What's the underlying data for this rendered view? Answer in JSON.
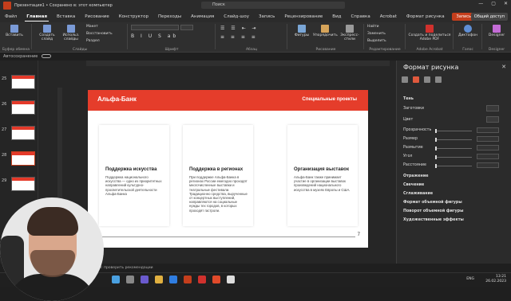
{
  "titlebar": {
    "title": "Презентация1 • Сохранено в: этот компьютер",
    "search_placeholder": "Поиск",
    "controls": [
      "—",
      "▢",
      "✕"
    ]
  },
  "ribbon_tabs": [
    "Файл",
    "Главная",
    "Вставка",
    "Рисование",
    "Конструктор",
    "Переходы",
    "Анимация",
    "Слайд-шоу",
    "Запись",
    "Рецензирование",
    "Вид",
    "Справка",
    "Acrobat",
    "Формат рисунка"
  ],
  "active_tab": "Главная",
  "share_label": "Запись",
  "share_button": "Общий доступ",
  "ribbon_groups": [
    {
      "label": "Буфер обмена",
      "buttons": [
        "Вставить"
      ]
    },
    {
      "label": "Слайды",
      "buttons": [
        "Создать слайд",
        "Использ. слайды",
        "Макет",
        "Восстановить",
        "Раздел"
      ]
    },
    {
      "label": "Шрифт",
      "buttons": []
    },
    {
      "label": "Абзац",
      "buttons": []
    },
    {
      "label": "Рисование",
      "buttons": [
        "Фигуры",
        "Упорядочить",
        "Экспресс-стили"
      ]
    },
    {
      "label": "Редактирование",
      "buttons": [
        "Найти",
        "Заменить",
        "Выделить"
      ]
    },
    {
      "label": "Adobe Acrobat",
      "buttons": [
        "Создать и поделиться Adobe PDF"
      ]
    },
    {
      "label": "Голос",
      "buttons": [
        "Диктофон"
      ]
    },
    {
      "label": "Designer",
      "buttons": [
        "Designer"
      ]
    }
  ],
  "autosave_label": "Автосохранение",
  "thumbnails": [
    {
      "num": "25"
    },
    {
      "num": "26"
    },
    {
      "num": "27"
    },
    {
      "num": "28"
    },
    {
      "num": "29"
    }
  ],
  "slide": {
    "brand": "Альфа-Банк",
    "header_right": "Специальные проекты",
    "page_number": "7",
    "cards": [
      {
        "title": "Поддержка искусства",
        "text": "Поддержка национального искусства — одно из приоритетных направлений культурно-просветительской деятельности Альфа-Банка"
      },
      {
        "title": "Поддержка в регионах",
        "text": "При поддержке Альфа-Банка в регионах России ежегодно проходят многочисленные выставки и театральные фестивали. Традиционно средства, вырученные от концертных выступлений, направляются на социальные нужды тех городов, в которых проходят гастроли."
      },
      {
        "title": "Организация выставок",
        "text": "Альфа-Банк также принимает участие в организации выставок произведений национального искусства в музеях Европы и США."
      }
    ]
  },
  "format_panel": {
    "title": "Формат рисунка",
    "section": "Тень",
    "rows": [
      "Заготовки",
      "Цвет",
      "Прозрачность",
      "Размер",
      "Размытие",
      "Угол",
      "Расстояние"
    ],
    "collapsed_sections": [
      "Отражение",
      "Свечение",
      "Сглаживание",
      "Формат объемной фигуры",
      "Поворот объемной фигуры",
      "Художественные эффекты"
    ]
  },
  "statusbar": {
    "text": "Слайд 28 из 32   Русский   Специальные возможности: проверить рекомендации"
  },
  "taskbar": {
    "lang": "ENG",
    "time": "13:21",
    "date": "26.02.2023"
  },
  "colors": {
    "accent": "#e53d2b",
    "ribbon": "#2f2f2f",
    "panel": "#2b2b2b"
  }
}
